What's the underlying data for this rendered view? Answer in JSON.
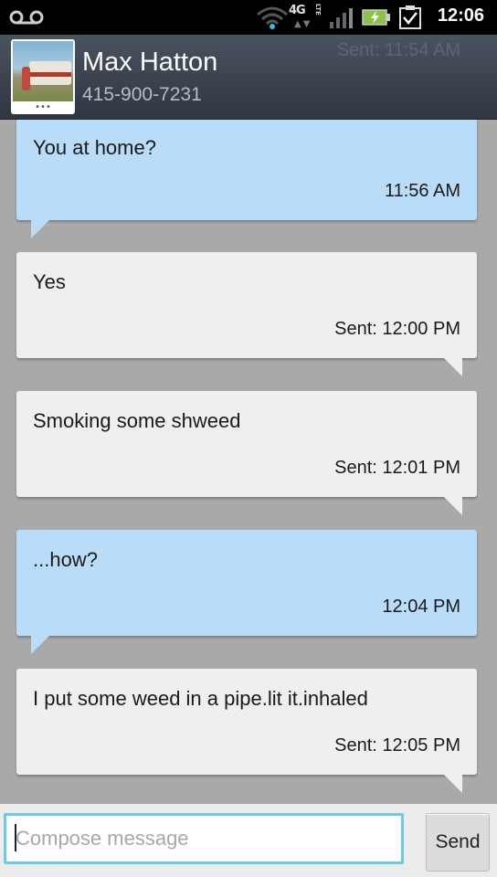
{
  "status_bar": {
    "time": "12:06",
    "network": "4G",
    "network_sub": "LTE",
    "icons": [
      "voicemail-icon",
      "wifi-icon",
      "signal-icon",
      "battery-charging-icon",
      "task-check-icon"
    ]
  },
  "header": {
    "contact_name": "Max Hatton",
    "contact_number": "415-900-7231",
    "ghost_text": "Sent: 11:54 AM",
    "avatar_dots": "•••"
  },
  "messages": [
    {
      "direction": "incoming",
      "text": "You at home?",
      "time": "11:56 AM"
    },
    {
      "direction": "outgoing",
      "text": "Yes",
      "time": "Sent: 12:00 PM"
    },
    {
      "direction": "outgoing",
      "text": "Smoking some shweed",
      "time": "Sent: 12:01 PM"
    },
    {
      "direction": "incoming",
      "text": "...how?",
      "time": "12:04 PM"
    },
    {
      "direction": "outgoing",
      "text": "I put some weed in a pipe.lit it.inhaled",
      "time": "Sent: 12:05 PM"
    }
  ],
  "compose": {
    "placeholder": "Compose message",
    "value": "",
    "send_label": "Send"
  },
  "colors": {
    "incoming_bubble": "#b9dcf9",
    "outgoing_bubble": "#efefef",
    "background": "#a9a9a9",
    "input_border": "#6ec9e6"
  }
}
